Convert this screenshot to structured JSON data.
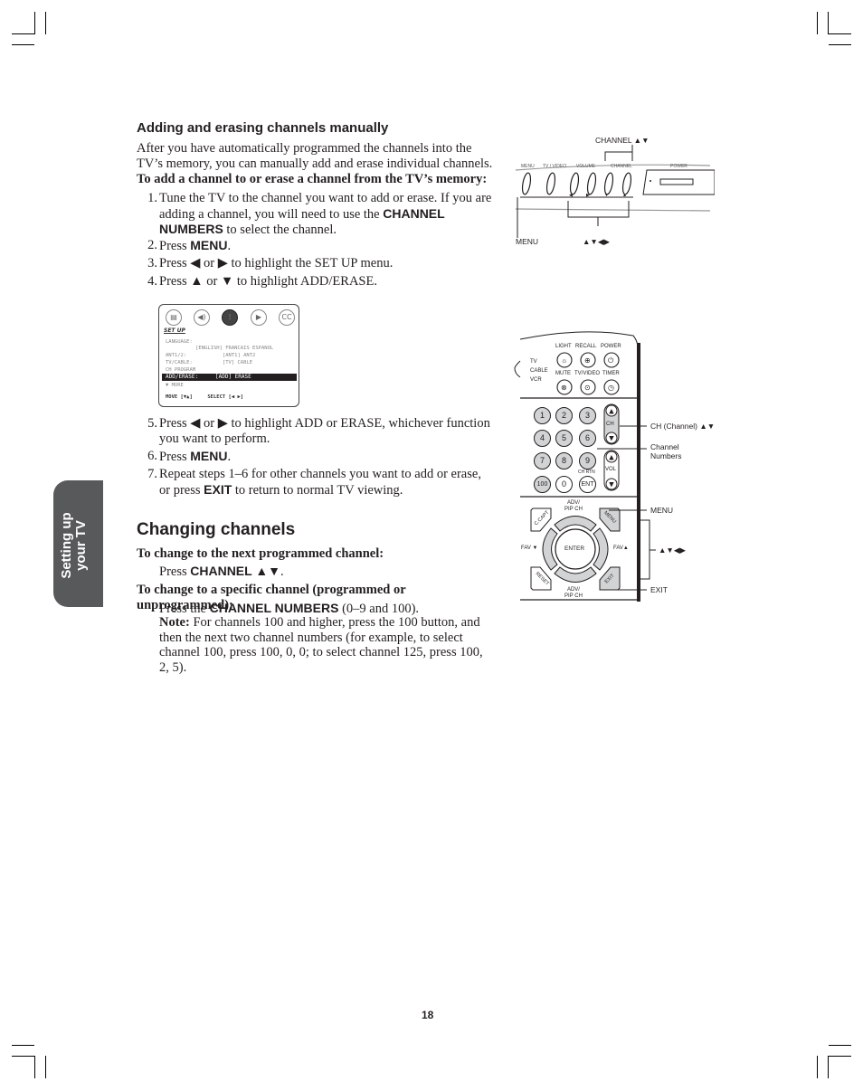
{
  "page": {
    "number": "18",
    "side_tab": [
      "Setting up",
      "your TV"
    ]
  },
  "section1": {
    "heading": "Adding and erasing channels manually",
    "intro": "After you have automatically programmed the channels into the TV’s memory, you can manually add and erase individual channels.",
    "subheading": "To add a channel to or erase a channel from the TV’s memory:",
    "steps": [
      {
        "num": "1.",
        "pre": "Tune the TV to the channel you want to add or erase. If you are adding a channel, you will need to use the ",
        "kw": "CHANNEL NUMBERS",
        "post": " to select the channel."
      },
      {
        "num": "2.",
        "pre": "Press ",
        "kw": "MENU",
        "post": "."
      },
      {
        "num": "3.",
        "text": "Press ◀ or ▶ to highlight the SET UP menu."
      },
      {
        "num": "4.",
        "text": "Press ▲ or ▼ to highlight ADD/ERASE."
      },
      {
        "num": "5.",
        "text": "Press ◀ or ▶ to highlight ADD or ERASE, whichever function you want to perform."
      },
      {
        "num": "6.",
        "pre": "Press ",
        "kw": "MENU",
        "post": "."
      },
      {
        "num": "7.",
        "pre": "Repeat steps 1–6 for other channels you want to add or erase, or press ",
        "kw": "EXIT",
        "post": " to return to normal TV viewing."
      }
    ]
  },
  "osd_menu": {
    "icons": [
      "picture-icon",
      "audio-icon",
      "setup-icon",
      "video-icon",
      "cc-icon"
    ],
    "cc_label": "CC",
    "title": "SET UP",
    "rows": [
      "LANGUAGE:",
      "          [ENGLISH] FRANCAIS ESPANOL",
      "ANT1/2:            [ANT1] ANT2",
      "TV/CABLE:          [TV] CABLE",
      "CH PROGRAM"
    ],
    "highlight_label": "ADD/ERASE:",
    "highlight_value": "[ADD] ERASE",
    "more": "▼ MORE",
    "footer": "MOVE [▼▲]     SELECT [◀ ▶]"
  },
  "section2": {
    "heading": "Changing channels",
    "sub1": "To change to the next programmed channel:",
    "sub1_pre": "Press ",
    "sub1_kw": "CHANNEL ▲▼",
    "sub1_post": ".",
    "sub2": "To change to a specific channel (programmed or unprogrammed):",
    "sub2_pre": "Press the ",
    "sub2_kw": "CHANNEL NUMBERS",
    "sub2_post": " (0–9 and 100).",
    "note_label": "Note:",
    "note_text": " For channels 100 and higher, press the 100 button, and then the next two channel numbers (for example, to select channel 100, press 100, 0, 0; to select channel 125, press 100, 2, 5)."
  },
  "tv_panel": {
    "callout_top": "CHANNEL ▲▼",
    "labels": [
      "MENU",
      "TV / VIDEO",
      "VOLUME",
      "CHANNEL",
      "POWER"
    ],
    "arrows": [
      "◀",
      "▶",
      "▼",
      "▲"
    ],
    "callout_menu": "MENU",
    "callout_arrows": "▲▼◀▶"
  },
  "remote": {
    "mode_labels": [
      "TV",
      "CABLE",
      "VCR"
    ],
    "top_labels": [
      "LIGHT",
      "RECALL",
      "POWER"
    ],
    "mid_labels": [
      "MUTE",
      "TV/VIDEO",
      "TIMER"
    ],
    "numbers": [
      "1",
      "2",
      "3",
      "4",
      "5",
      "6",
      "7",
      "8",
      "9",
      "100",
      "0",
      "ENT"
    ],
    "ch_label": "CH",
    "vol_label": "VOL",
    "ch_rtn": "CH RTN",
    "adv_pip_top": "ADV/\nPIP CH",
    "adv_pip_bottom": "ADV/\nPIP CH",
    "enter": "ENTER",
    "fav_left": "FAV ▼",
    "fav_right": "FAV▲",
    "corner_buttons": [
      "C.CAPT",
      "MENU",
      "RESET",
      "EXIT"
    ],
    "callouts": {
      "ch": "CH (Channel) ▲▼",
      "numbers": "Channel\nNumbers",
      "menu": "MENU",
      "arrows": "▲▼◀▶",
      "exit": "EXIT"
    }
  }
}
